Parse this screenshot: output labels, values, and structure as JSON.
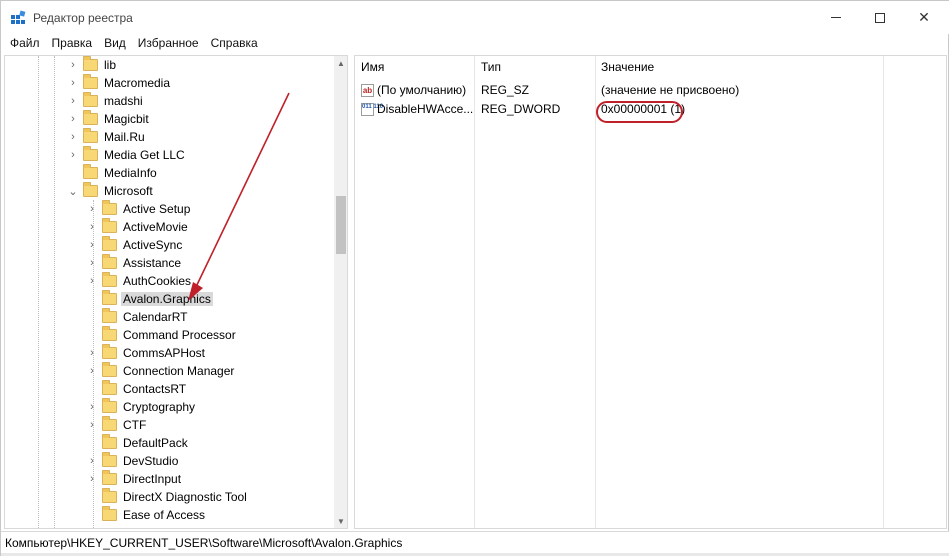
{
  "window": {
    "title": "Редактор реестра",
    "controls": {
      "minimize": "—",
      "maximize": "☐",
      "close": "✕"
    }
  },
  "menu": [
    "Файл",
    "Правка",
    "Вид",
    "Избранное",
    "Справка"
  ],
  "tree": {
    "items": [
      {
        "label": "lib",
        "expander": "›"
      },
      {
        "label": "Macromedia",
        "expander": "›"
      },
      {
        "label": "madshi",
        "expander": "›"
      },
      {
        "label": "Magicbit",
        "expander": "›"
      },
      {
        "label": "Mail.Ru",
        "expander": "›"
      },
      {
        "label": "Media Get LLC",
        "expander": "›"
      },
      {
        "label": "MediaInfo",
        "expander": ""
      },
      {
        "label": "Microsoft",
        "expander": "⌄"
      },
      {
        "label": "Active Setup",
        "expander": "›"
      },
      {
        "label": "ActiveMovie",
        "expander": "›"
      },
      {
        "label": "ActiveSync",
        "expander": "›"
      },
      {
        "label": "Assistance",
        "expander": "›"
      },
      {
        "label": "AuthCookies",
        "expander": "›"
      },
      {
        "label": "Avalon.Graphics",
        "expander": ""
      },
      {
        "label": "CalendarRT",
        "expander": ""
      },
      {
        "label": "Command Processor",
        "expander": ""
      },
      {
        "label": "CommsAPHost",
        "expander": "›"
      },
      {
        "label": "Connection Manager",
        "expander": "›"
      },
      {
        "label": "ContactsRT",
        "expander": ""
      },
      {
        "label": "Cryptography",
        "expander": "›"
      },
      {
        "label": "CTF",
        "expander": "›"
      },
      {
        "label": "DefaultPack",
        "expander": ""
      },
      {
        "label": "DevStudio",
        "expander": "›"
      },
      {
        "label": "DirectInput",
        "expander": "›"
      },
      {
        "label": "DirectX Diagnostic Tool",
        "expander": ""
      },
      {
        "label": "Ease of Access",
        "expander": ""
      }
    ],
    "selected": "Avalon.Graphics"
  },
  "values": {
    "headers": {
      "name": "Имя",
      "type": "Тип",
      "data": "Значение"
    },
    "rows": [
      {
        "icon": "ab",
        "name": "(По умолчанию)",
        "type": "REG_SZ",
        "data": "(значение не присвоено)"
      },
      {
        "icon": "011 110",
        "name": "DisableHWAcce...",
        "type": "REG_DWORD",
        "data": "0x00000001 (1)"
      }
    ]
  },
  "status": {
    "path": "Компьютер\\HKEY_CURRENT_USER\\Software\\Microsoft\\Avalon.Graphics"
  },
  "colors": {
    "annotation": "#c0202a",
    "selection": "#d9d9d9",
    "folder": "#f8d775"
  }
}
